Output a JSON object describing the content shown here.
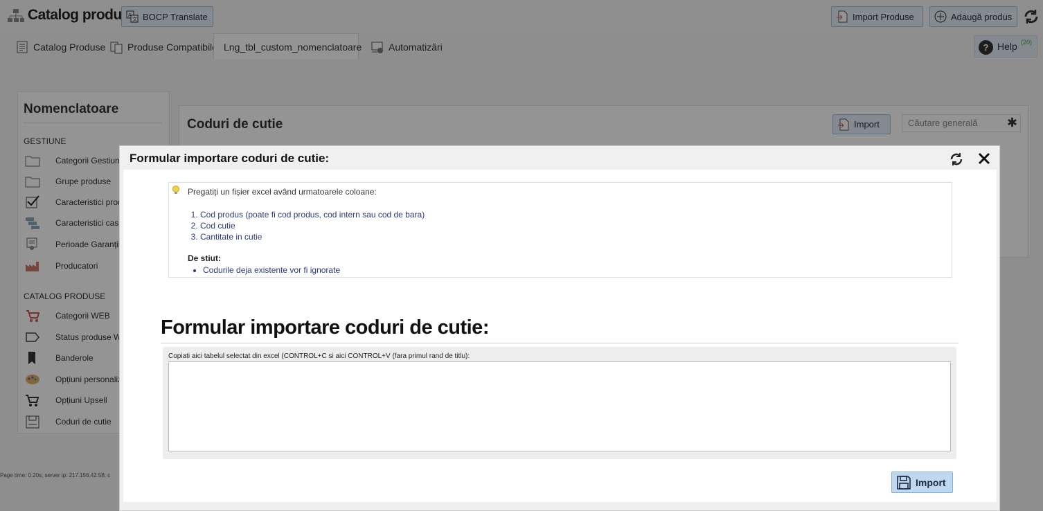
{
  "header": {
    "title": "Catalog produse",
    "translate_label": "BOCP Translate",
    "import_label": "Import Produse",
    "add_label": "Adaugă produs"
  },
  "tabs": [
    {
      "label": "Catalog Produse"
    },
    {
      "label": "Produse Compatibile"
    },
    {
      "label": "Lng_tbl_custom_nomenclatoare"
    },
    {
      "label": "Automatizări"
    }
  ],
  "help": {
    "label": "Help",
    "count": "(20)"
  },
  "sidebar": {
    "title": "Nomenclatoare",
    "section1": "GESTIUNE",
    "section1_items": [
      {
        "label": "Categorii Gestiune"
      },
      {
        "label": "Grupe produse"
      },
      {
        "label": "Caracteristici produse"
      },
      {
        "label": "Caracteristici cascadă"
      },
      {
        "label": "Perioade Garanții"
      },
      {
        "label": "Producatori"
      }
    ],
    "section2": "CATALOG PRODUSE",
    "section2_items": [
      {
        "label": "Categorii WEB"
      },
      {
        "label": "Status produse WEB"
      },
      {
        "label": "Banderole"
      },
      {
        "label": "Opțiuni personalizare"
      },
      {
        "label": "Opțiuni Upsell"
      },
      {
        "label": "Coduri de cutie"
      }
    ]
  },
  "panel": {
    "title": "Coduri de cutie",
    "import_label": "Import",
    "search_placeholder": "Căutare generală"
  },
  "footer": {
    "page_time": "Page time: 0.20s; server ip: 217.156.42.58; c"
  },
  "modal": {
    "title": "Formular importare coduri de cutie:",
    "intro": "Pregatiți un fișier excel având urmatoarele coloane:",
    "columns": [
      "Cod produs (poate fi cod produs, cod intern sau cod de bara)",
      "Cod cutie",
      "Cantitate in cutie"
    ],
    "know_label": "De stiut:",
    "notes": [
      "Codurile deja existente vor fi ignorate"
    ],
    "form_title": "Formular importare coduri de cutie:",
    "form_label": "Copiati aici tabelul selectat din excel (CONTROL+C si aici CONTROL+V (fara primul rand de titlu):",
    "textarea_value": "",
    "import_label": "Import"
  },
  "colors": {
    "accent": "#bfd8ee",
    "overlay": "#6b6b6b"
  }
}
